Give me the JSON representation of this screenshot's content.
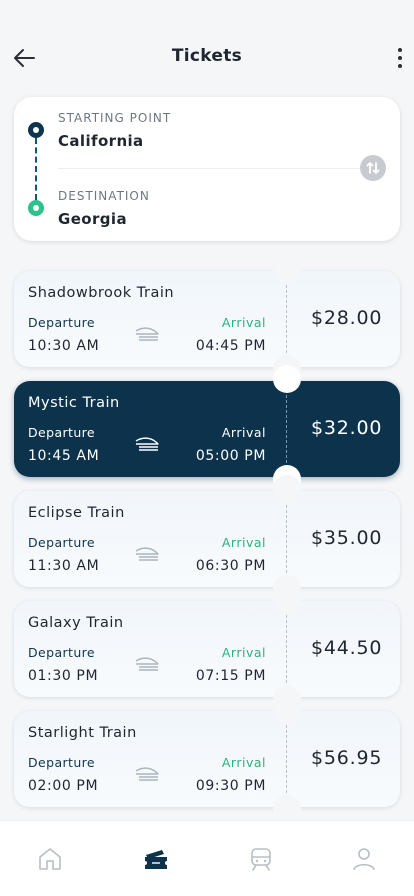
{
  "header": {
    "title": "Tickets",
    "back_icon": "arrow-left-icon",
    "menu_icon": "more-vertical-icon"
  },
  "route": {
    "starting_label": "STARTING POINT",
    "starting_value": "California",
    "destination_label": "DESTINATION",
    "destination_value": "Georgia",
    "swap_icon": "swap-vertical-icon"
  },
  "tickets": [
    {
      "name": "Shadowbrook Train",
      "departure_label": "Departure",
      "departure_time": "10:30 AM",
      "arrival_label": "Arrival",
      "arrival_time": "04:45 PM",
      "price": "$28.00"
    },
    {
      "name": "Mystic Train",
      "departure_label": "Departure",
      "departure_time": "10:45 AM",
      "arrival_label": "Arrival",
      "arrival_time": "05:00 PM",
      "price": "$32.00",
      "selected": true
    },
    {
      "name": "Eclipse Train",
      "departure_label": "Departure",
      "departure_time": "11:30 AM",
      "arrival_label": "Arrival",
      "arrival_time": "06:30 PM",
      "price": "$35.00"
    },
    {
      "name": "Galaxy Train",
      "departure_label": "Departure",
      "departure_time": "01:30 PM",
      "arrival_label": "Arrival",
      "arrival_time": "07:15 PM",
      "price": "$44.50"
    },
    {
      "name": "Starlight Train",
      "departure_label": "Departure",
      "departure_time": "02:00 PM",
      "arrival_label": "Arrival",
      "arrival_time": "09:30 PM",
      "price": "$56.95"
    }
  ],
  "nav": {
    "items": [
      {
        "icon": "home-icon",
        "active": false
      },
      {
        "icon": "ticket-icon",
        "active": true
      },
      {
        "icon": "train-icon",
        "active": false
      },
      {
        "icon": "profile-icon",
        "active": false
      }
    ]
  },
  "colors": {
    "primary": "#0c324c",
    "accent_green": "#2cc28c",
    "background": "#f4f6f8"
  }
}
